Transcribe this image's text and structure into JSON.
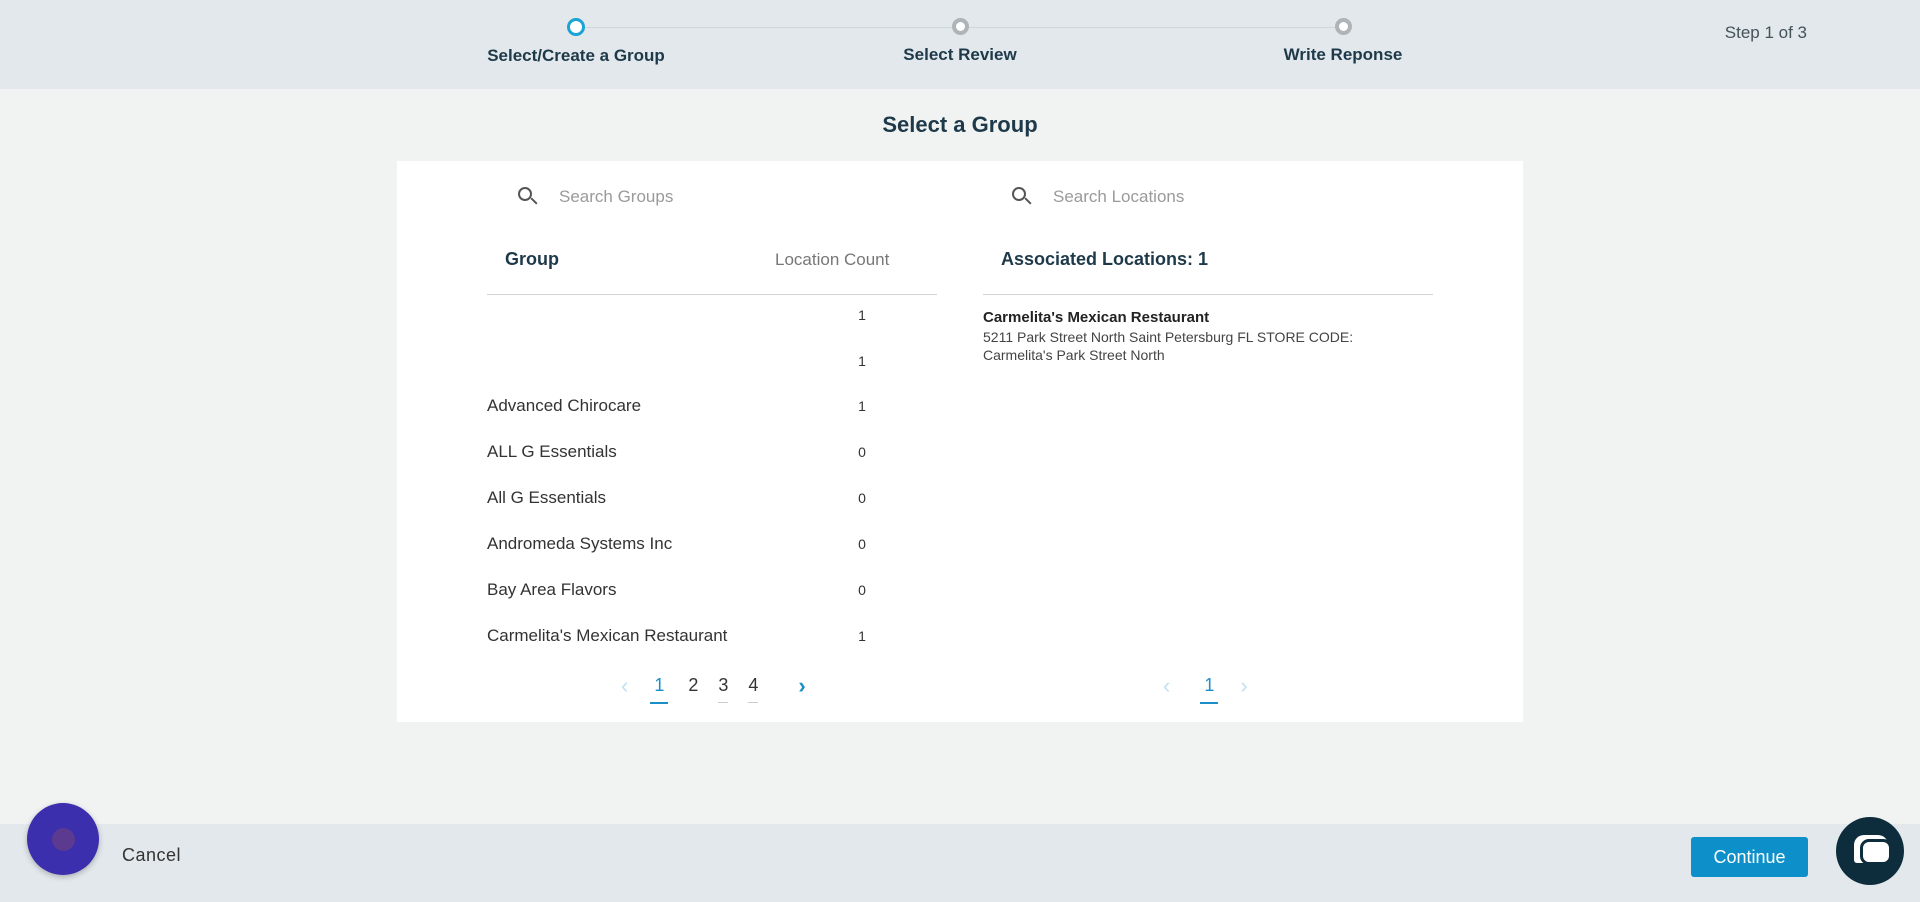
{
  "stepper": {
    "steps": [
      {
        "label": "Select/Create a Group",
        "state": "active"
      },
      {
        "label": "Select Review",
        "state": "inactive"
      },
      {
        "label": "Write Reponse",
        "state": "inactive"
      }
    ],
    "counter": "Step 1 of 3"
  },
  "page": {
    "title": "Select a Group"
  },
  "groups": {
    "search_placeholder": "Search Groups",
    "col_group": "Group",
    "col_count": "Location Count",
    "rows": [
      {
        "name": "",
        "count": "1"
      },
      {
        "name": "",
        "count": "1"
      },
      {
        "name": "Advanced Chirocare",
        "count": "1"
      },
      {
        "name": "ALL G Essentials",
        "count": "0"
      },
      {
        "name": "All G Essentials",
        "count": "0"
      },
      {
        "name": "Andromeda Systems Inc",
        "count": "0"
      },
      {
        "name": "Bay Area Flavors",
        "count": "0"
      },
      {
        "name": "Carmelita's Mexican Restaurant",
        "count": "1"
      }
    ],
    "pagination": {
      "prev": "‹",
      "pages": [
        "1",
        "2",
        "3",
        "4"
      ],
      "current": "1",
      "next": "›"
    }
  },
  "locations": {
    "search_placeholder": "Search Locations",
    "header": "Associated Locations: 1",
    "items": [
      {
        "name": "Carmelita's Mexican Restaurant",
        "address": "5211 Park Street North  Saint Petersburg FL STORE CODE: Carmelita's Park Street North"
      }
    ],
    "pagination": {
      "prev": "‹",
      "pages": [
        "1"
      ],
      "current": "1",
      "next": "›"
    }
  },
  "footer": {
    "cancel_label": "Cancel",
    "continue_label": "Continue"
  },
  "colors": {
    "accent": "#0d90c9",
    "header_bg": "#e2e8eb",
    "title": "#1e3a4a",
    "assistant": "#3b2fae",
    "chat": "#0e2d3c"
  },
  "icons": [
    "search-icon",
    "chevron-left-icon",
    "chevron-right-icon",
    "assistant-icon",
    "chat-icon"
  ]
}
